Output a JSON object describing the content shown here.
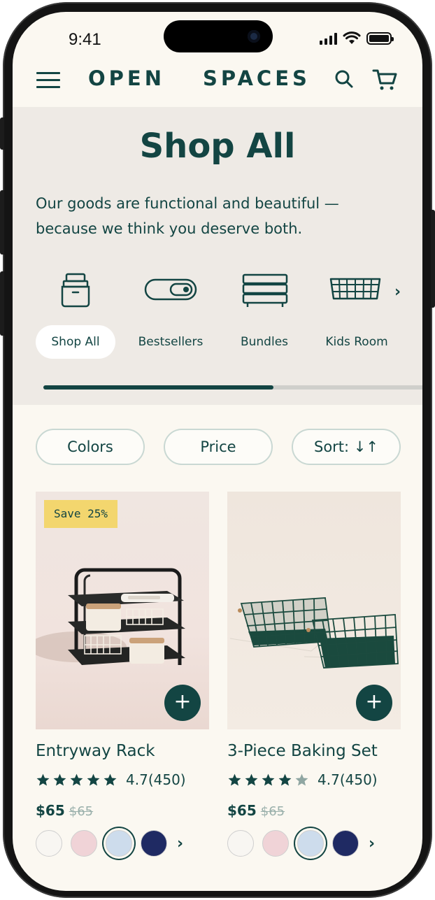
{
  "status": {
    "time": "9:41"
  },
  "header": {
    "brand_left": "OPEN",
    "brand_right": "SPACES"
  },
  "hero": {
    "title": "Shop All",
    "subtitle": "Our goods are functional and beautiful — because we think you deserve both."
  },
  "categories": [
    {
      "label": "Shop All",
      "icon": "storage-bin-icon",
      "active": true
    },
    {
      "label": "Bestsellers",
      "icon": "toggle-container-icon",
      "active": false
    },
    {
      "label": "Bundles",
      "icon": "stacked-trays-icon",
      "active": false
    },
    {
      "label": "Kids Room",
      "icon": "wire-basket-icon",
      "active": false
    }
  ],
  "category_scroll_progress": 0.6,
  "filters": {
    "colors": "Colors",
    "price": "Price",
    "sort": "Sort: ↓↑"
  },
  "products": [
    {
      "name": "Entryway Rack",
      "badge": "Save 25%",
      "rating": "4.7",
      "reviews": "(450)",
      "stars": 5,
      "price": "$65",
      "old_price": "$65",
      "swatches": [
        "#f8f6f2",
        "#f0d3d7",
        "#cddcec",
        "#1f2a63"
      ],
      "selected_swatch": 2
    },
    {
      "name": "3-Piece Baking Set",
      "badge": "",
      "rating": "4.7",
      "reviews": "(450)",
      "stars": 4,
      "price": "$65",
      "old_price": "$65",
      "swatches": [
        "#f8f6f2",
        "#f0d3d7",
        "#cddcec",
        "#1f2a63"
      ],
      "selected_swatch": 2
    }
  ],
  "colors": {
    "brand": "#134543",
    "badge": "#f3d66e",
    "background": "#fbf8f1",
    "hero_bg": "#eeeae5"
  }
}
